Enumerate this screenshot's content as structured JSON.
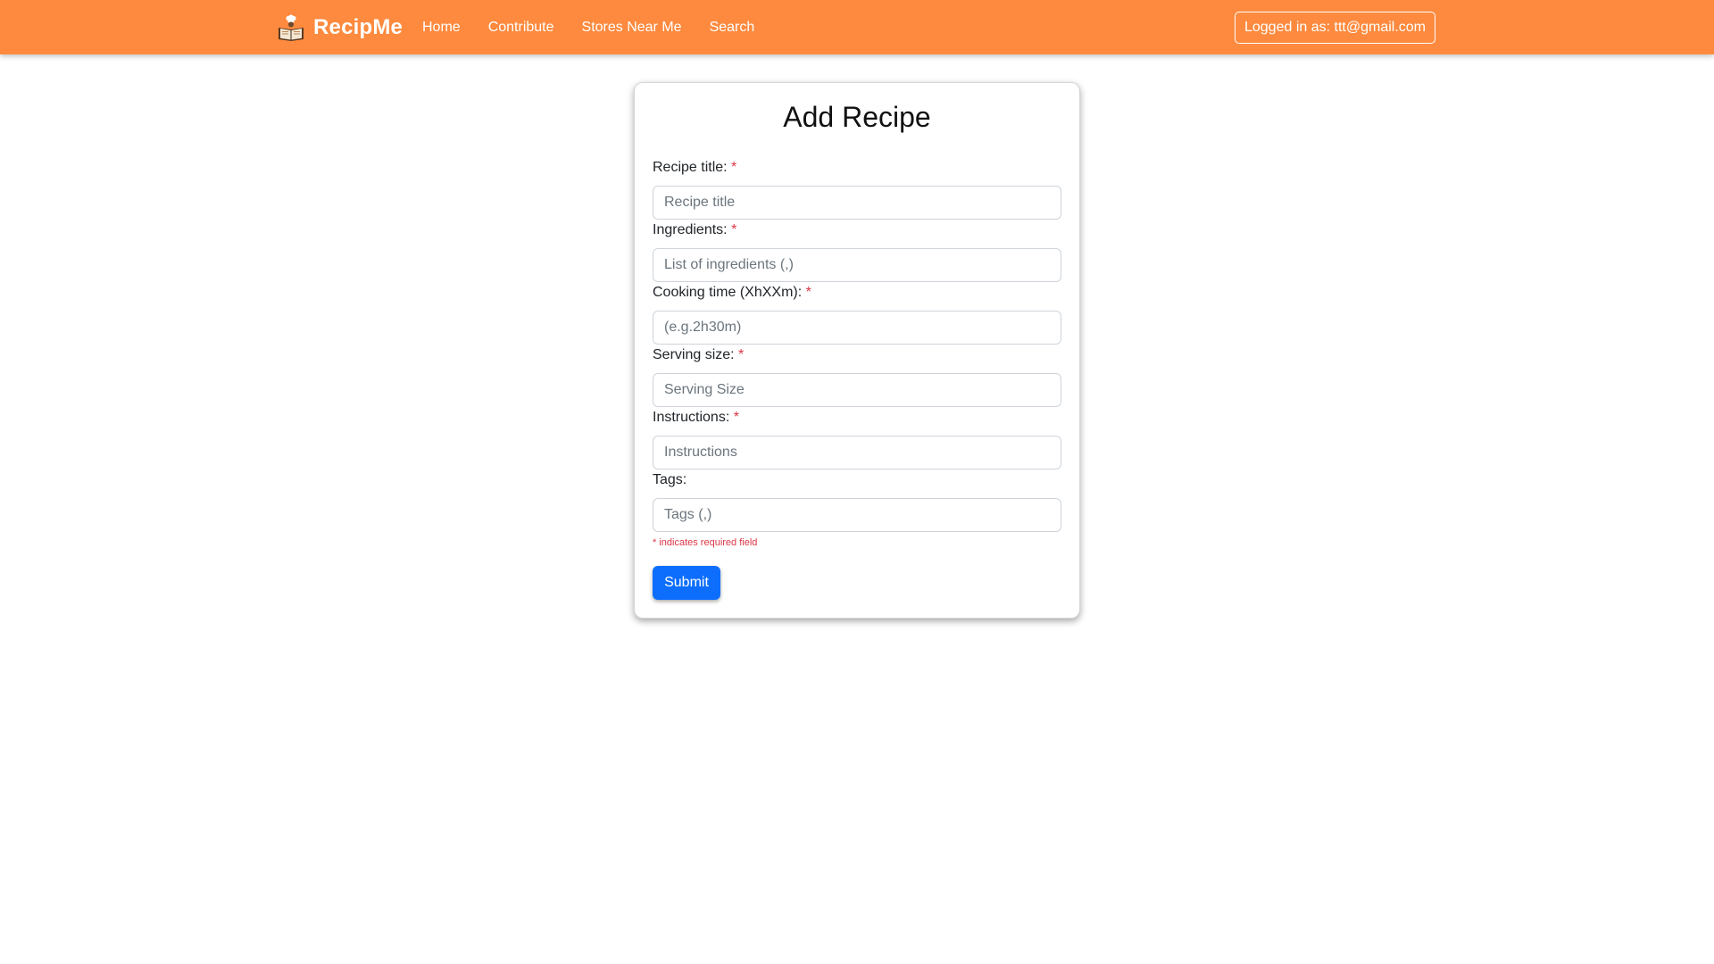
{
  "navbar": {
    "brand": "RecipMe",
    "links": [
      "Home",
      "Contribute",
      "Stores Near Me",
      "Search"
    ],
    "login_status": "Logged in as: ttt@gmail.com",
    "background_color": "#fd8a3e"
  },
  "form": {
    "title": "Add Recipe",
    "required_marker": "*",
    "fields": {
      "recipe_title": {
        "label": "Recipe title:",
        "placeholder": "Recipe title",
        "value": ""
      },
      "ingredients": {
        "label": "Ingredients:",
        "placeholder": "List of ingredients (,)",
        "value": ""
      },
      "cooking_time": {
        "label": "Cooking time (XhXXm):",
        "placeholder": "(e.g.2h30m)",
        "value": ""
      },
      "serving_size": {
        "label": "Serving size:",
        "placeholder": "Serving Size",
        "value": ""
      },
      "instructions": {
        "label": "Instructions:",
        "placeholder": "Instructions",
        "value": ""
      },
      "tags": {
        "label": "Tags:",
        "placeholder": "Tags (,)",
        "value": ""
      }
    },
    "required_note": "* indicates required field",
    "submit_label": "Submit",
    "submit_color": "#0d6efd",
    "required_color": "#dc3545"
  },
  "icons": {
    "brand_icon": "recipe-book-chef-icon"
  }
}
